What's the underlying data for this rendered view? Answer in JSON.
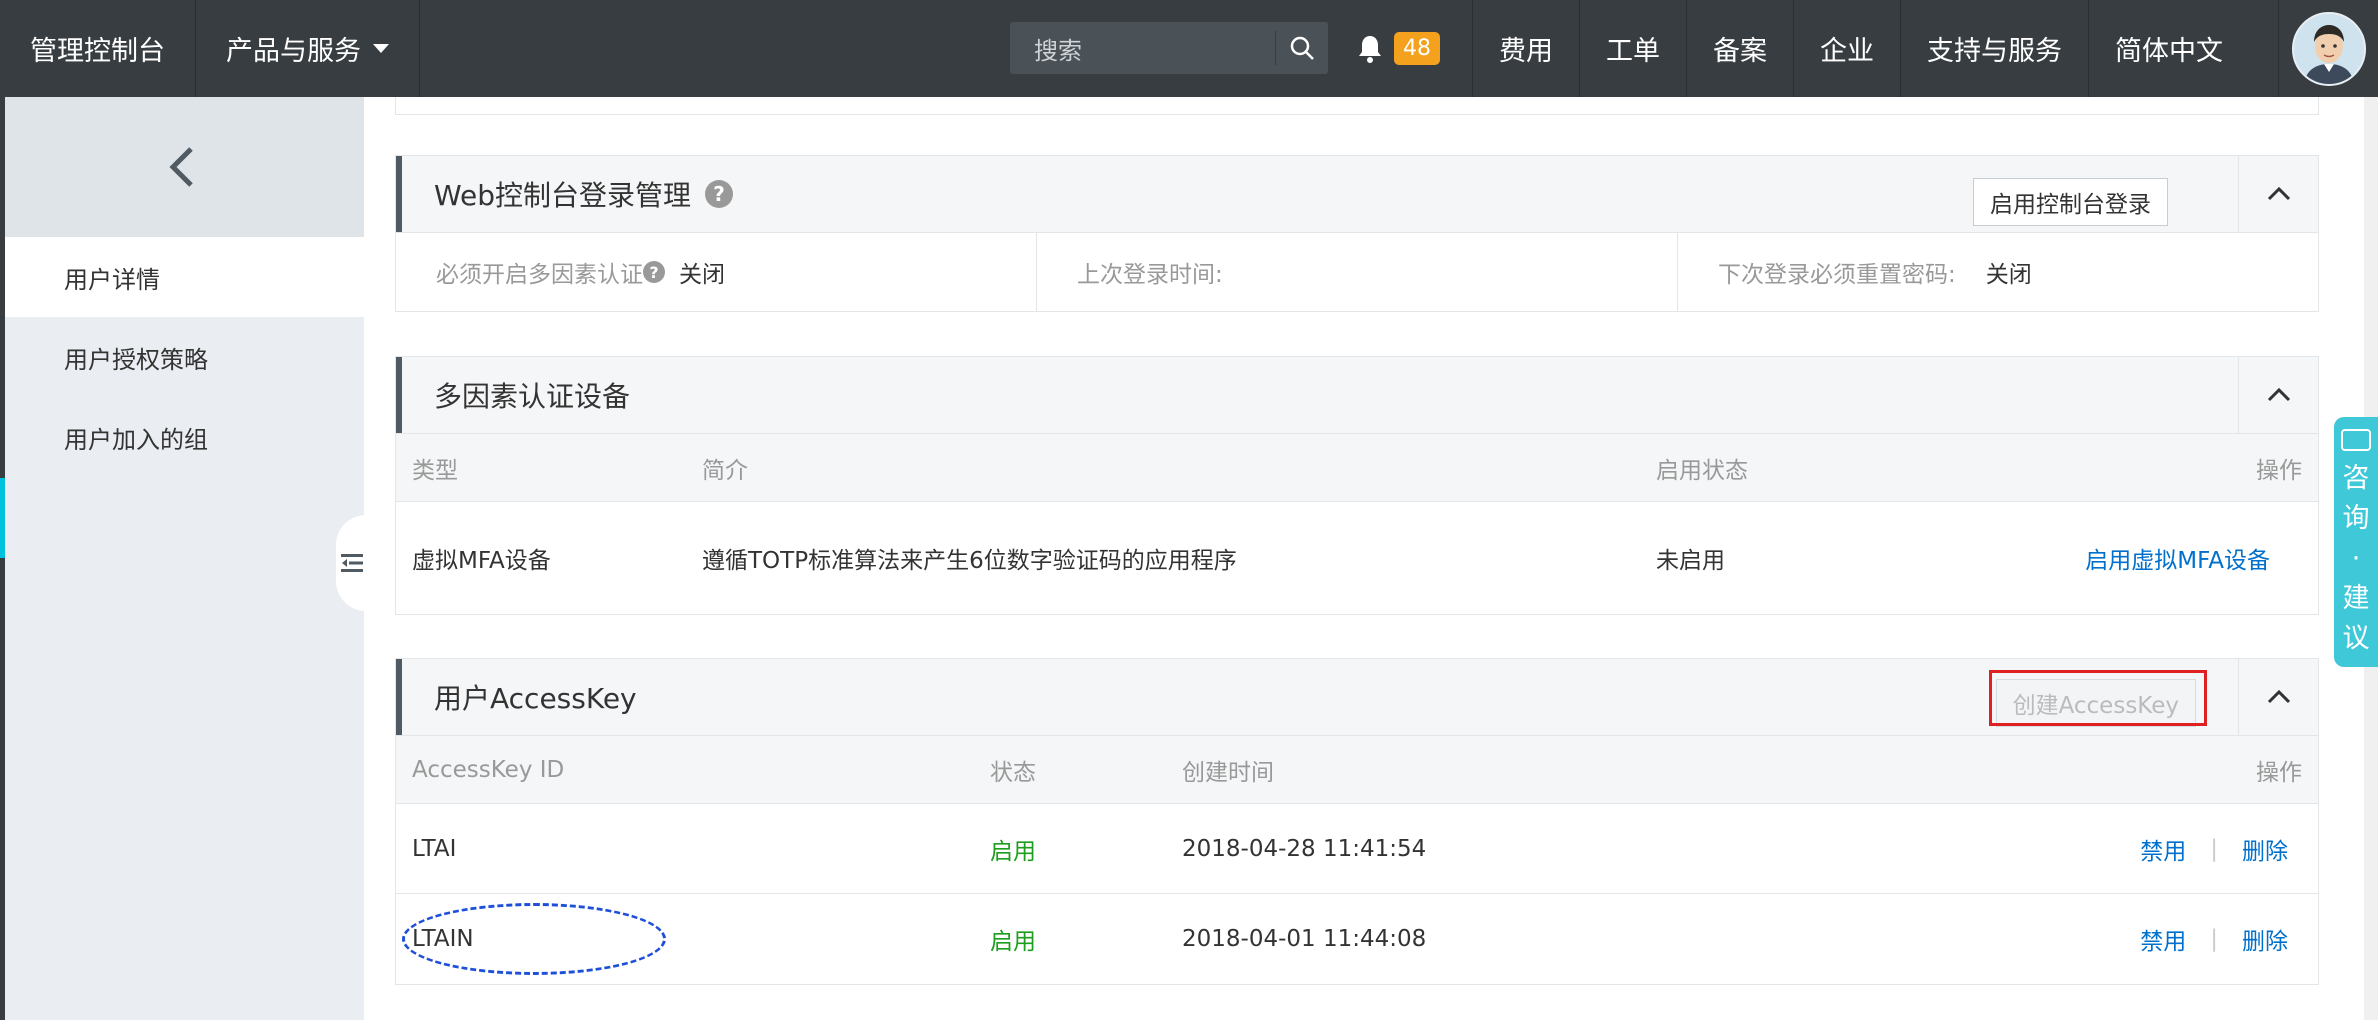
{
  "topbar": {
    "brand": "管理控制台",
    "products": "产品与服务",
    "search_placeholder": "搜索",
    "notification_count": "48",
    "menu": [
      "费用",
      "工单",
      "备案",
      "企业",
      "支持与服务",
      "简体中文"
    ]
  },
  "sidebar": {
    "items": [
      {
        "label": "用户详情",
        "active": true
      },
      {
        "label": "用户授权策略",
        "active": false
      },
      {
        "label": "用户加入的组",
        "active": false
      }
    ]
  },
  "console_login": {
    "title": "Web控制台登录管理",
    "enable_button": "启用控制台登录",
    "mfa_required_label": "必须开启多因素认证",
    "mfa_required_value": "关闭",
    "last_login_label": "上次登录时间:",
    "last_login_value": "",
    "reset_pwd_label": "下次登录必须重置密码:",
    "reset_pwd_value": "关闭"
  },
  "mfa": {
    "title": "多因素认证设备",
    "headers": {
      "type": "类型",
      "desc": "简介",
      "status": "启用状态",
      "action": "操作"
    },
    "rows": [
      {
        "type": "虚拟MFA设备",
        "desc": "遵循TOTP标准算法来产生6位数字验证码的应用程序",
        "status": "未启用",
        "action": "启用虚拟MFA设备"
      }
    ]
  },
  "accesskey": {
    "title": "用户AccessKey",
    "create_button": "创建AccessKey",
    "headers": {
      "id": "AccessKey ID",
      "status": "状态",
      "created": "创建时间",
      "action": "操作"
    },
    "rows": [
      {
        "id": "LTAI",
        "status": "启用",
        "created": "2018-04-28 11:41:54",
        "disable": "禁用",
        "delete": "删除"
      },
      {
        "id": "LTAIN",
        "status": "启用",
        "created": "2018-04-01 11:44:08",
        "disable": "禁用",
        "delete": "删除"
      }
    ]
  },
  "consult_tab": "咨询·建议",
  "colors": {
    "topbar": "#373d41",
    "accent": "#00c1de",
    "link": "#0070cc",
    "enabled": "#1e9e1e",
    "highlight": "#e02020",
    "annotation": "#1e4fd8"
  }
}
